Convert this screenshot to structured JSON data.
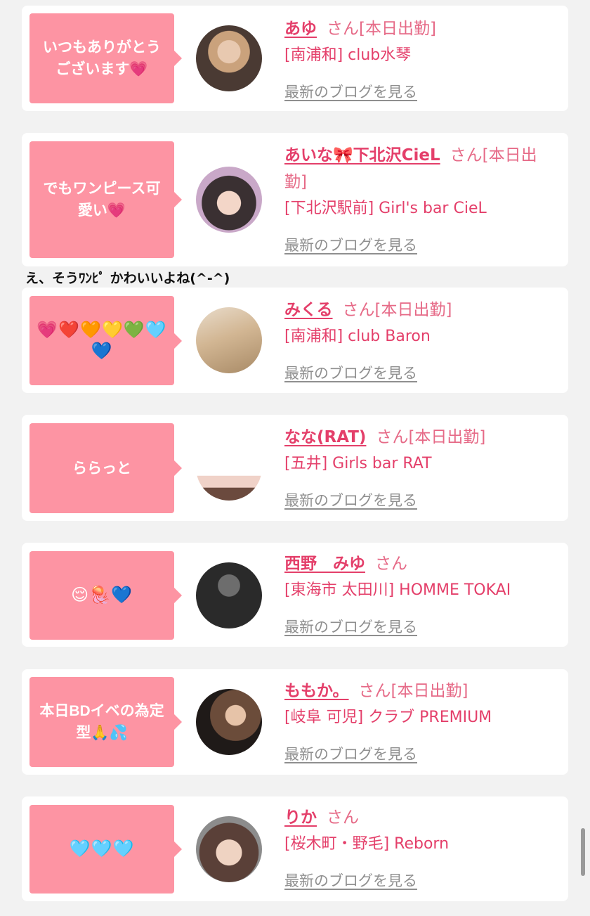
{
  "comment": "え、そうﾜﾝﾋﾟ かわいいよね(^-^)",
  "cards": [
    {
      "bubble": "いつもありがとうございます💗",
      "name": "あゆ",
      "san": "さん[本日出勤]",
      "shop": "[南浦和] club水琴",
      "blog": "最新のブログを見る"
    },
    {
      "bubble": "でもワンピース可愛い💗",
      "name": "あいな🎀下北沢CieL",
      "san": "さん[本日出勤]",
      "shop": "[下北沢駅前] Girl's bar CieL",
      "blog": "最新のブログを見る"
    },
    {
      "bubble": "💗❤️🧡💛💚🩵💙",
      "name": "みくる",
      "san": "さん[本日出勤]",
      "shop": "[南浦和] club Baron",
      "blog": "最新のブログを見る"
    },
    {
      "bubble": "ららっと",
      "name": "なな(RAT)",
      "san": "さん[本日出勤]",
      "shop": "[五井] Girls bar RAT",
      "blog": "最新のブログを見る"
    },
    {
      "bubble": "😌🪼💙",
      "name": "西野　みゆ",
      "san": "さん",
      "shop": "[東海市 太田川] HOMME TOKAI",
      "blog": "最新のブログを見る"
    },
    {
      "bubble": "本日BDイベの為定型🙏💦",
      "name": "ももか。",
      "san": "さん[本日出勤]",
      "shop": "[岐阜 可児] クラブ PREMIUM",
      "blog": "最新のブログを見る"
    },
    {
      "bubble": "🩵🩵🩵",
      "name": "りか",
      "san": "さん",
      "shop": "[桜木町・野毛] Reborn",
      "blog": "最新のブログを見る"
    }
  ],
  "colors": {
    "background": "#f2f2f2",
    "bubble": "#fd94a3",
    "name": "#e43f6a",
    "blog_link": "#8f8f8f"
  }
}
